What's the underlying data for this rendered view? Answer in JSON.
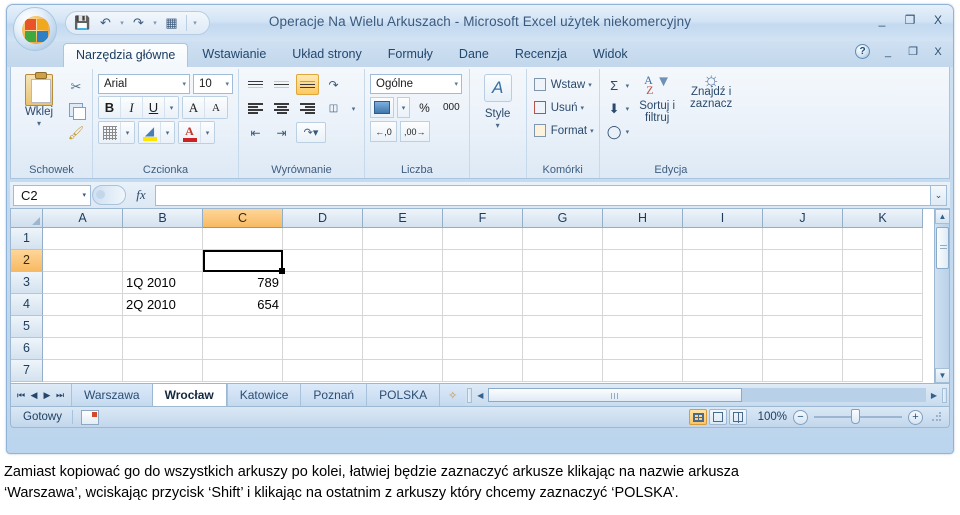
{
  "window": {
    "title": "Operacje Na Wielu Arkuszach - Microsoft Excel użytek niekomercyjny",
    "minimize": "_",
    "restore": "❐",
    "close": "X"
  },
  "quick_access": {
    "save": "save-icon",
    "undo": "undo-icon",
    "redo": "redo-icon",
    "print_preview": "print-preview-icon",
    "customize": "▾"
  },
  "ribbon": {
    "tabs": [
      {
        "label": "Narzędzia główne",
        "active": true
      },
      {
        "label": "Wstawianie",
        "active": false
      },
      {
        "label": "Układ strony",
        "active": false
      },
      {
        "label": "Formuły",
        "active": false
      },
      {
        "label": "Dane",
        "active": false
      },
      {
        "label": "Recenzja",
        "active": false
      },
      {
        "label": "Widok",
        "active": false
      }
    ],
    "help": "?",
    "groups": {
      "clipboard": {
        "label": "Schowek",
        "paste": "Wklej",
        "paste_caret": "▾"
      },
      "font": {
        "label": "Czcionka",
        "font_name": "Arial",
        "font_size": "10",
        "bold": "B",
        "italic": "I",
        "underline": "U",
        "grow_font": "A",
        "shrink_font": "A"
      },
      "alignment": {
        "label": "Wyrównanie"
      },
      "number": {
        "label": "Liczba",
        "format": "Ogólne",
        "percent": "%",
        "comma": "000"
      },
      "styles": {
        "label": "Style",
        "button": "Style",
        "caret": "▾"
      },
      "cells": {
        "label": "Komórki",
        "insert": "Wstaw",
        "delete": "Usuń",
        "format": "Format"
      },
      "editing": {
        "label": "Edycja",
        "sum": "Σ",
        "sort_filter_l1": "Sortuj i",
        "sort_filter_l2": "filtruj",
        "find_select_l1": "Znajdź i",
        "find_select_l2": "zaznacz"
      }
    }
  },
  "formula_bar": {
    "name_box": "C2",
    "fx": "fx",
    "value": "",
    "expand": "⌄"
  },
  "sheet": {
    "columns": [
      "A",
      "B",
      "C",
      "D",
      "E",
      "F",
      "G",
      "H",
      "I",
      "J",
      "K"
    ],
    "selected_column": "C",
    "rows": [
      "1",
      "2",
      "3",
      "4",
      "5",
      "6",
      "7"
    ],
    "selected_row": "2",
    "active_cell": "C2",
    "cells": [
      {
        "row": "3",
        "col": "B",
        "value": "1Q 2010",
        "align": "left"
      },
      {
        "row": "3",
        "col": "C",
        "value": "789",
        "align": "right"
      },
      {
        "row": "4",
        "col": "B",
        "value": "2Q 2010",
        "align": "left"
      },
      {
        "row": "4",
        "col": "C",
        "value": "654",
        "align": "right"
      }
    ]
  },
  "sheet_tabs": {
    "nav": [
      "⏮",
      "◀",
      "▶",
      "⏭"
    ],
    "items": [
      {
        "label": "Warszawa",
        "active": false
      },
      {
        "label": "Wrocław",
        "active": true
      },
      {
        "label": "Katowice",
        "active": false
      },
      {
        "label": "Poznań",
        "active": false
      },
      {
        "label": "POLSKA",
        "active": false
      }
    ],
    "insert_sheet": "insert-worksheet-icon"
  },
  "status_bar": {
    "status": "Gotowy",
    "zoom": "100%",
    "zoom_out": "−",
    "zoom_in": "+",
    "views": [
      "normal-view-icon",
      "page-layout-view-icon",
      "page-break-view-icon"
    ]
  },
  "caption": {
    "line1": "Zamiast kopiować go do wszystkich arkuszy po kolei, łatwiej będzie zaznaczyć arkusze klikając na nazwie arkusza",
    "line2": "‘Warszawa’, wciskając przycisk ‘Shift’ i klikając na ostatnim z arkuszy który chcemy zaznaczyć ‘POLSKA’."
  },
  "colors": {
    "accent": "#f7ba62",
    "chrome": "#c3d9ef",
    "text": "#1f3f61"
  }
}
